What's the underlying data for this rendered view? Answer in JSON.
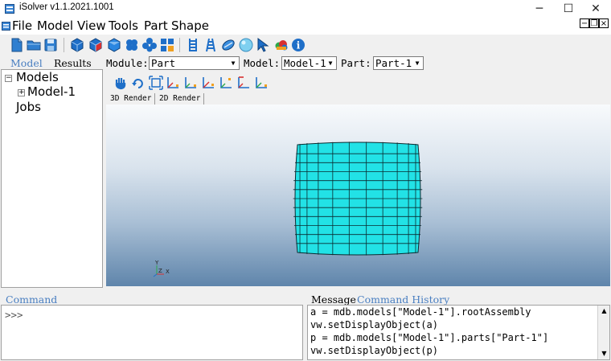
{
  "window": {
    "title": "iSolver v1.1.2021.1001",
    "minimize_glyph": "─",
    "maximize_glyph": "☐",
    "close_glyph": "✕"
  },
  "menu": {
    "items": [
      "File",
      "Model",
      "View",
      "Tools",
      "Part",
      "Shape"
    ],
    "mdi_minimize": "−",
    "mdi_restore": "❐",
    "mdi_close": "×"
  },
  "toolbar": {
    "icons": [
      "new-file-icon",
      "open-folder-icon",
      "save-icon",
      "cube-icon",
      "cube-red-icon",
      "cube-blue-icon",
      "clover-icon",
      "clover-alt-icon",
      "mesh-grid-icon",
      "ladder-icon",
      "ladder-alt-icon",
      "bolt-icon",
      "sphere-icon",
      "cursor-icon",
      "cloud-icon",
      "info-icon"
    ],
    "info_glyph": "i"
  },
  "left_panel": {
    "tabs": [
      "Model",
      "Results"
    ],
    "active_tab": "Model",
    "tree": {
      "root": "Models",
      "child": "Model-1",
      "jobs": "Jobs",
      "expand_glyph_root": "−",
      "expand_glyph_child": "+"
    }
  },
  "module_bar": {
    "module_label": "Module:",
    "module_value": "Part",
    "model_label": "Model:",
    "model_value": "Model-1",
    "part_label": "Part:",
    "part_value": "Part-1",
    "combo_arrow": "▼"
  },
  "view_toolbar": {
    "icons": [
      "pan-hand-icon",
      "rotate-icon",
      "fit-view-icon",
      "view-front-icon",
      "view-back-icon",
      "view-top-icon",
      "view-bottom-icon",
      "view-left-icon",
      "view-iso-icon"
    ]
  },
  "render_tabs": [
    "3D Render",
    "2D Render"
  ],
  "viewport": {
    "triad_labels": {
      "y": "Y",
      "z": "Z",
      "x": "X"
    },
    "mesh": {
      "rows": 12,
      "cols": 11,
      "fill": "#22e2e6",
      "line": "#0a2b30"
    }
  },
  "command": {
    "label": "Command",
    "prompt": ">>>"
  },
  "message": {
    "tabs": [
      "Message",
      "Command History"
    ],
    "active_tab": "Message",
    "lines": [
      "a = mdb.models[\"Model-1\"].rootAssembly",
      "vw.setDisplayObject(a)",
      "p = mdb.models[\"Model-1\"].parts[\"Part-1\"]",
      "vw.setDisplayObject(p)"
    ],
    "scroll_up": "▲",
    "scroll_down": "▼"
  },
  "colors": {
    "accent_tab": "#4a7fc1",
    "mesh_fill": "#22e2e6"
  }
}
